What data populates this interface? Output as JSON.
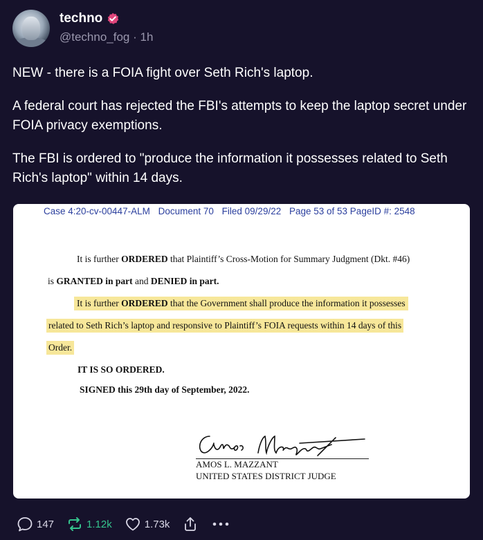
{
  "post": {
    "author_name": "techno",
    "handle": "@techno_fog",
    "separator": "·",
    "time_ago": "1h",
    "paragraphs": [
      "NEW - there is a FOIA fight over Seth Rich's laptop.",
      "A federal court has rejected the FBI's attempts to keep the laptop secret under FOIA privacy exemptions.",
      "The FBI is ordered to \"produce the information it possesses related to Seth Rich's laptop\" within 14 days."
    ]
  },
  "document": {
    "header": {
      "case": "Case 4:20-cv-00447-ALM",
      "doc": "Document 70",
      "filed": "Filed 09/29/22",
      "page": "Page 53 of 53 PageID #:  2548"
    },
    "line1_a": "It is further ",
    "line1_b": "ORDERED",
    "line1_c": " that Plaintiff’s Cross-Motion for Summary Judgment (Dkt. #46)",
    "line2_a": "is ",
    "line2_b": "GRANTED in part",
    "line2_c": " and ",
    "line2_d": "DENIED in part.",
    "line3_a": "It is further ",
    "line3_b": "ORDERED",
    "line3_c": " that the Government shall produce the information it possesses",
    "line4": "related to Seth Rich’s laptop and responsive to Plaintiff’s FOIA requests within 14 days of this",
    "line5": "Order.",
    "so_ordered": "IT IS SO ORDERED.",
    "signed": "SIGNED this 29th day of September, 2022.",
    "judge_name": "AMOS L. MAZZANT",
    "judge_title": "UNITED STATES DISTRICT JUDGE"
  },
  "actions": {
    "replies": "147",
    "reposts": "1.12k",
    "likes": "1.73k"
  },
  "colors": {
    "background": "#16122b",
    "verified_badge": "#e0457b",
    "repost_green": "#35c48d",
    "highlight": "#f7e79a",
    "doc_header_blue": "#2b3f9e"
  }
}
